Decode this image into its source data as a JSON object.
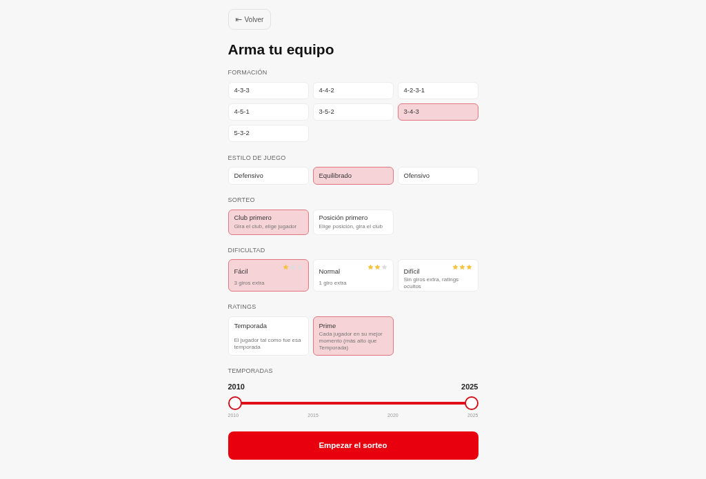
{
  "back_button": {
    "label": "Volver"
  },
  "title": "Arma tu equipo",
  "formation": {
    "label": "FORMACIÓN",
    "options": [
      {
        "label": "4-3-3",
        "selected": false
      },
      {
        "label": "4-4-2",
        "selected": false
      },
      {
        "label": "4-2-3-1",
        "selected": false
      },
      {
        "label": "4-5-1",
        "selected": false
      },
      {
        "label": "3-5-2",
        "selected": false
      },
      {
        "label": "3-4-3",
        "selected": true
      },
      {
        "label": "5-3-2",
        "selected": false
      }
    ]
  },
  "style": {
    "label": "ESTILO DE JUEGO",
    "options": [
      {
        "label": "Defensivo",
        "selected": false
      },
      {
        "label": "Equilibrado",
        "selected": true
      },
      {
        "label": "Ofensivo",
        "selected": false
      }
    ]
  },
  "draw": {
    "label": "SORTEO",
    "options": [
      {
        "title": "Club primero",
        "description": "Gira el club, elige jugador",
        "selected": true
      },
      {
        "title": "Posición primero",
        "description": "Elige posición, gira el club",
        "selected": false
      }
    ]
  },
  "difficulty": {
    "label": "DIFICULTAD",
    "options": [
      {
        "title": "Fácil",
        "description": "3 giros extra",
        "stars": 1,
        "selected": true
      },
      {
        "title": "Normal",
        "description": "1 giro extra",
        "stars": 2,
        "selected": false
      },
      {
        "title": "Difícil",
        "description": "Sin giros extra, ratings ocultos",
        "stars": 3,
        "selected": false
      }
    ]
  },
  "ratings": {
    "label": "RATINGS",
    "options": [
      {
        "title": "Temporada",
        "description": "El jugador tal como fue esa temporada",
        "selected": false
      },
      {
        "title": "Prime",
        "description": "Cada jugador en su mejor momento (más alto que Temporada)",
        "selected": true
      }
    ]
  },
  "seasons": {
    "label": "TEMPORADAS",
    "from": "2010",
    "to": "2025",
    "thumbs": [
      {
        "level": 0
      },
      {
        "level": 1
      }
    ],
    "ticks": [
      "2010",
      "2015",
      "2020",
      "2025"
    ]
  },
  "start_button": {
    "label": "Empezar el sorteo"
  }
}
